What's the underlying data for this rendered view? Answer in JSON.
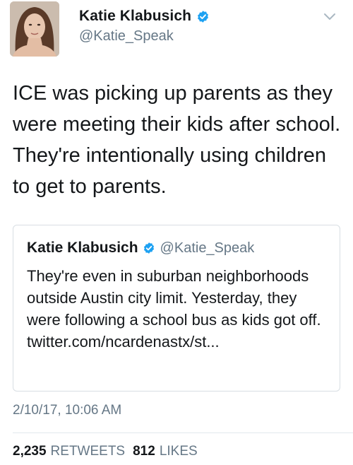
{
  "tweet": {
    "author": {
      "display_name": "Katie Klabusich",
      "handle": "@Katie_Speak",
      "verified": true
    },
    "text": "ICE was picking up parents as they were meeting their kids after school. They're intentionally using children to get to parents.",
    "timestamp": "2/10/17, 10:06 AM",
    "stats": {
      "retweets_count": "2,235",
      "retweets_label": "RETWEETS",
      "likes_count": "812",
      "likes_label": "LIKES"
    }
  },
  "quoted_tweet": {
    "display_name": "Katie Klabusich",
    "handle": "@Katie_Speak",
    "verified": true,
    "text": "They're even in suburban neighborhoods outside Austin city limit. Yesterday, they were following a school bus as kids got off. twitter.com/ncardenastx/st..."
  },
  "icons": {
    "verified": "verified-badge-icon",
    "menu": "chevron-down-icon"
  },
  "colors": {
    "verified_blue": "#1da1f2",
    "secondary_text": "#657786",
    "primary_text": "#14171a",
    "border": "#d8dee3"
  }
}
